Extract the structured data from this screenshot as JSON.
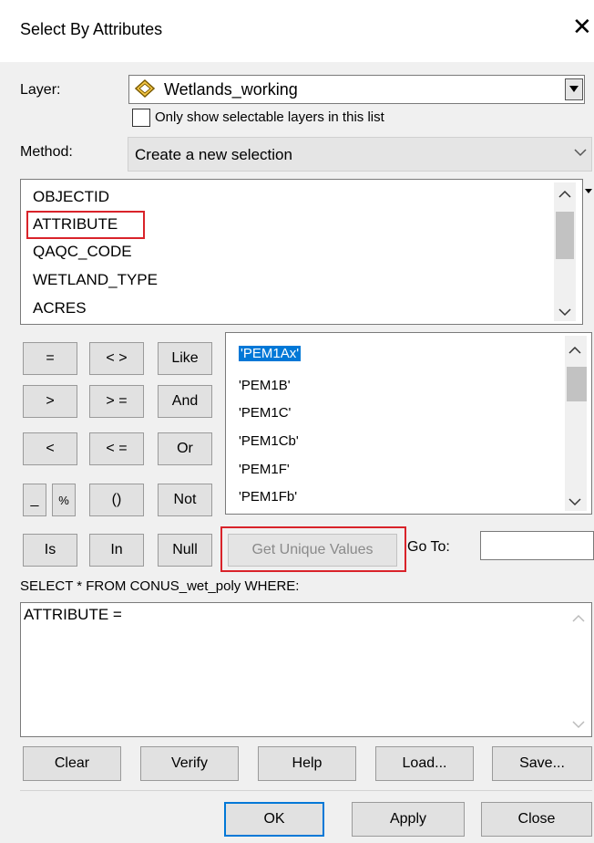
{
  "window": {
    "title": "Select By Attributes",
    "close_icon": "close-icon"
  },
  "layer": {
    "label": "Layer:",
    "value": "Wetlands_working",
    "icon": "layer-icon",
    "only_selectable_label": "Only show selectable layers in this list",
    "only_selectable_checked": false
  },
  "method": {
    "label": "Method:",
    "value": "Create a new selection"
  },
  "fields": [
    "OBJECTID",
    "ATTRIBUTE",
    "QAQC_CODE",
    "WETLAND_TYPE",
    "ACRES"
  ],
  "highlighted_field": "ATTRIBUTE",
  "operators": {
    "eq": "=",
    "neq": "< >",
    "like": "Like",
    "gt": ">",
    "gte": "> =",
    "and": "And",
    "lt": "<",
    "lte": "< =",
    "or": "Or",
    "underscore": "_",
    "percent": "%",
    "parens": "()",
    "not": "Not",
    "is": "Is",
    "in": "In",
    "null": "Null"
  },
  "values": [
    "'PEM1Ax'",
    "'PEM1B'",
    "'PEM1C'",
    "'PEM1Cb'",
    "'PEM1F'",
    "'PEM1Fb'"
  ],
  "selected_value": "'PEM1Ax'",
  "get_unique_values_label": "Get Unique Values",
  "goto": {
    "label": "Go To:",
    "value": ""
  },
  "query": {
    "header": "SELECT * FROM CONUS_wet_poly WHERE:",
    "expression": "ATTRIBUTE ="
  },
  "buttons": {
    "clear": "Clear",
    "verify": "Verify",
    "help": "Help",
    "load": "Load...",
    "save": "Save...",
    "ok": "OK",
    "apply": "Apply",
    "close": "Close"
  },
  "colors": {
    "highlight_box": "#d9232a",
    "selection": "#0078d7"
  }
}
